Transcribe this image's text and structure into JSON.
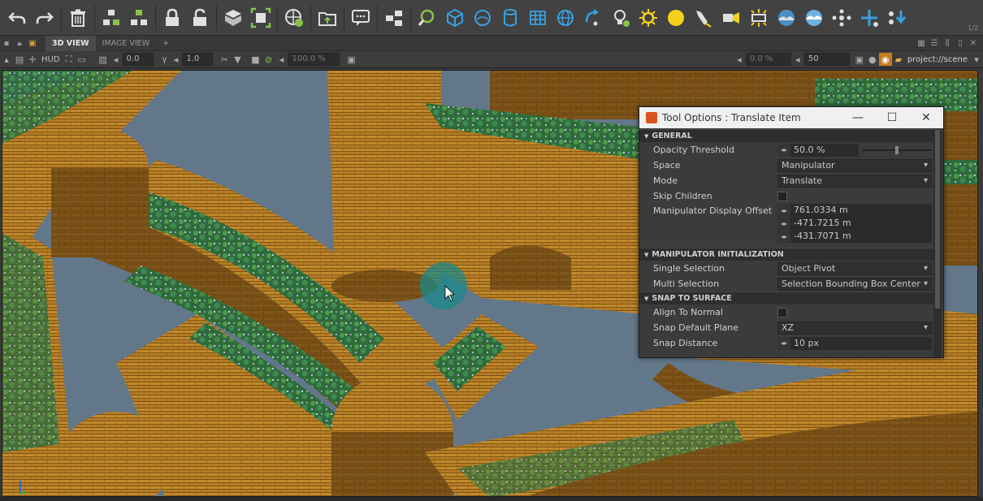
{
  "pager": "1/2",
  "tabs": {
    "view3d": "3D VIEW",
    "image_view": "IMAGE VIEW",
    "add": "+"
  },
  "vpbar": {
    "hud": "HUD",
    "field1": "0.0",
    "gamma_label": "γ",
    "field2": "1.0",
    "field3": "100.0 %",
    "field4": "0.0 %",
    "field5": "50",
    "path": "project://scene"
  },
  "panel": {
    "title": "Tool Options : Translate Item",
    "sections": {
      "general": "GENERAL",
      "manip_init": "MANIPULATOR INITIALIZATION",
      "snap": "SNAP TO SURFACE"
    },
    "rows": {
      "opacity_label": "Opacity Threshold",
      "opacity_value": "50.0 %",
      "opacity_fraction": 0.5,
      "space_label": "Space",
      "space_value": "Manipulator",
      "mode_label": "Mode",
      "mode_value": "Translate",
      "skip_label": "Skip Children",
      "offset_label": "Manipulator Display Offset",
      "offset_x": "761.0334 m",
      "offset_y": "-471.7215 m",
      "offset_z": "-431.7071 m",
      "single_label": "Single Selection",
      "single_value": "Object Pivot",
      "multi_label": "Multi Selection",
      "multi_value": "Selection Bounding Box Center",
      "align_label": "Align To Normal",
      "plane_label": "Snap Default Plane",
      "plane_value": "XZ",
      "distance_label": "Snap Distance",
      "distance_value": "10 px"
    }
  },
  "colors": {
    "accent_blue": "#3aa0e0",
    "toolbar_bg": "#424242",
    "panel_bg": "#3b3b3b",
    "manipulator_teal": "#1a8a8a",
    "sun_yellow": "#f2d21a"
  },
  "icons": [
    "undo-icon",
    "redo-icon",
    "trash-icon",
    "group-icon",
    "ungroup-icon",
    "lock-icon",
    "unlock-icon",
    "box-icon",
    "fit-icon",
    "globe-refresh-icon",
    "export-icon",
    "comment-icon",
    "hierarchy-icon",
    "search-refresh-icon",
    "cube-icon",
    "sphere-icon",
    "cylinder-icon",
    "grid-icon",
    "globe-icon",
    "arrow-icon",
    "light-bulb-icon",
    "sun-icon",
    "yellow-sphere-icon",
    "flashlight-icon",
    "projector-icon",
    "area-light-icon",
    "sky-icon",
    "sky-blue-icon",
    "nodes-icon",
    "add-node-icon",
    "download-node-icon"
  ]
}
